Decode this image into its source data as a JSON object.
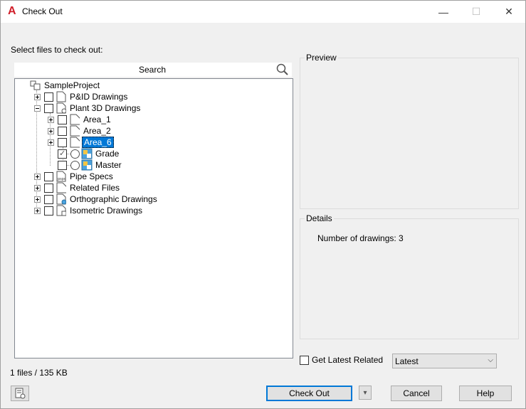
{
  "window": {
    "title": "Check Out",
    "app_icon": "autocad-a-icon"
  },
  "titlebar_buttons": {
    "minimize": "—",
    "maximize": "☐",
    "close": "✕"
  },
  "select_label": "Select files to check out:",
  "search": {
    "label": "Search"
  },
  "tree": {
    "root": "SampleProject",
    "items": {
      "pid": "P&ID Drawings",
      "plant3d": "Plant 3D Drawings",
      "area1": "Area_1",
      "area2": "Area_2",
      "area6": "Area_6",
      "grade": "Grade",
      "master": "Master",
      "pipespecs": "Pipe Specs",
      "related": "Related Files",
      "ortho": "Orthographic Drawings",
      "iso": "Isometric Drawings"
    },
    "grade_checked": true
  },
  "preview": {
    "title": "Preview"
  },
  "details": {
    "title": "Details",
    "text": "Number of drawings: 3"
  },
  "get_latest": {
    "label": "Get Latest Related",
    "checked": false
  },
  "dropdown": {
    "value": "Latest"
  },
  "status": "1 files / 135 KB",
  "buttons": {
    "checkout": "Check Out",
    "cancel": "Cancel",
    "help": "Help",
    "split_arrow": "▾"
  }
}
